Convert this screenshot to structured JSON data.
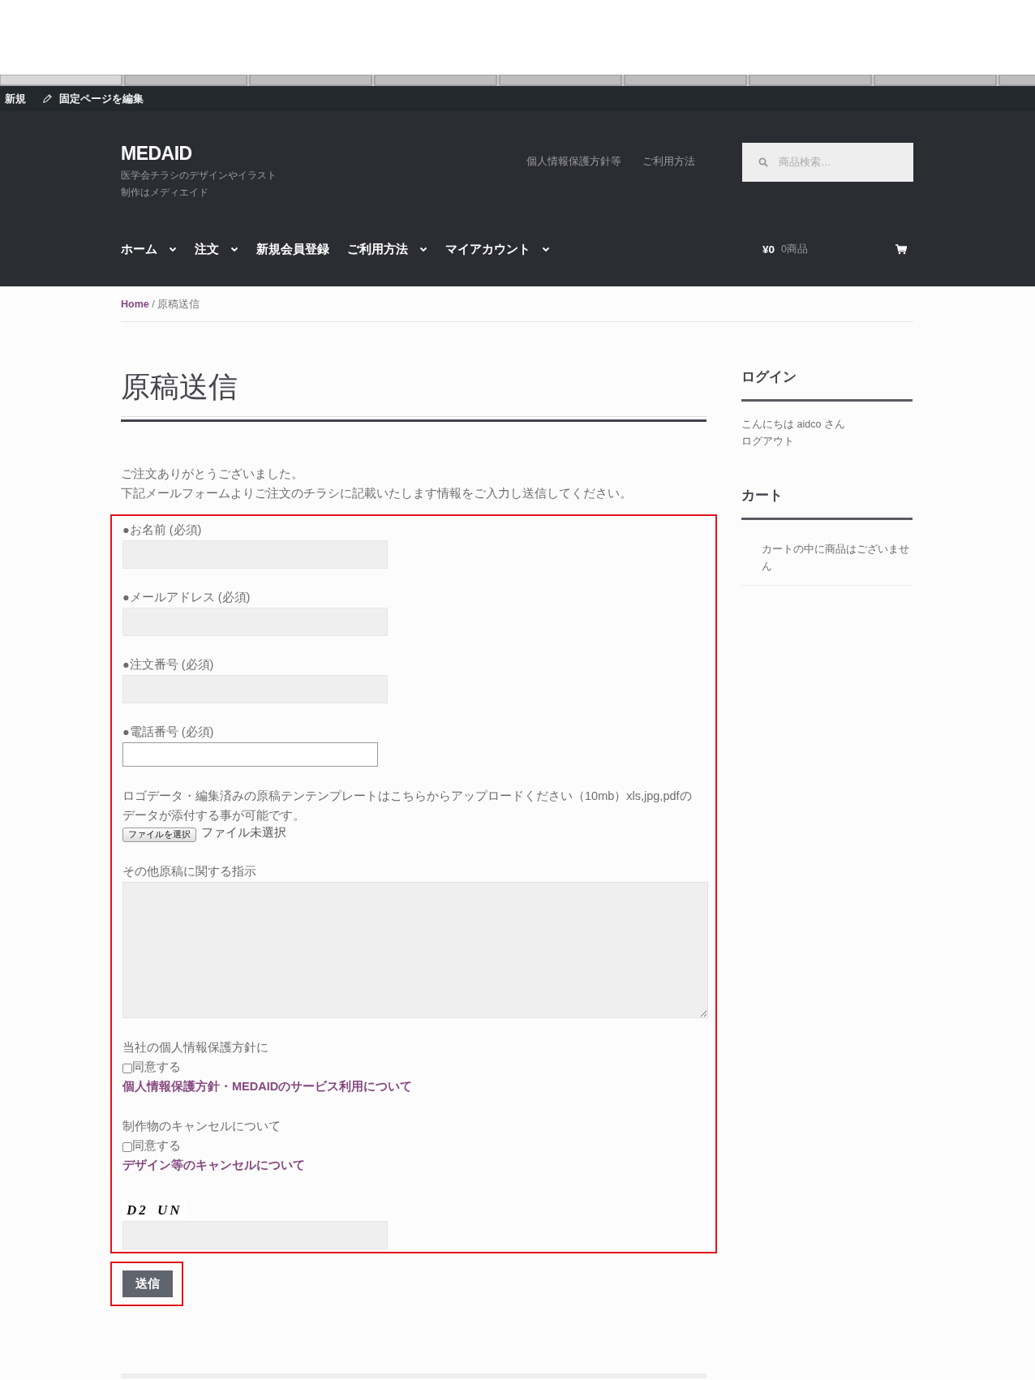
{
  "admin_bar": {
    "new": "新規",
    "edit": "固定ページを編集"
  },
  "header": {
    "site_title": "MEDAID",
    "tagline": [
      "医学会チラシのデザインやイラスト",
      "制作はメディエイド"
    ],
    "top_links": [
      "個人情報保護方針等",
      "ご利用方法"
    ],
    "search": {
      "placeholder": "商品検索…"
    },
    "nav": [
      {
        "label": "ホーム",
        "has_submenu": true
      },
      {
        "label": "注文",
        "has_submenu": true
      },
      {
        "label": "新規会員登録",
        "has_submenu": false
      },
      {
        "label": "ご利用方法",
        "has_submenu": true
      },
      {
        "label": "マイアカウント",
        "has_submenu": true
      }
    ],
    "cart": {
      "amount": "¥0",
      "count": "0商品"
    }
  },
  "breadcrumb": {
    "home": "Home",
    "separator": "/",
    "current": "原稿送信"
  },
  "page": {
    "title": "原稿送信",
    "intro": [
      "ご注文ありがとうございました。",
      "下記メールフォームよりご注文のチラシに記載いたします情報をご入力し送信してください。"
    ]
  },
  "form": {
    "highlighted": true,
    "fields": [
      {
        "label": "●お名前 (必須)",
        "kind": "shaded"
      },
      {
        "label": "●メールアドレス (必須)",
        "kind": "shaded"
      },
      {
        "label": "●注文番号 (必須)",
        "kind": "shaded"
      },
      {
        "label": "●電話番号 (必須)",
        "kind": "plain"
      }
    ],
    "upload": {
      "text": "ロゴデータ・編集済みの原稿テンテンプレートはこちらからアップロードください（10mb）xls,jpg,pdfのデータが添付する事が可能です。",
      "button": "ファイルを選択",
      "status": "ファイル未選択"
    },
    "message": {
      "label": "その他原稿に関する指示"
    },
    "agreements": [
      {
        "text": "当社の個人情報保護方針に",
        "checkbox": "同意する",
        "checked": false,
        "link": "個人情報保護方針・MEDAIDのサービス利用について"
      },
      {
        "text": "制作物のキャンセルについて",
        "checkbox": "同意する",
        "checked": false,
        "link": "デザイン等のキャンセルについて"
      }
    ],
    "captcha": "D2 UN",
    "submit": {
      "label": "送信",
      "highlighted": true
    }
  },
  "sidebar": [
    {
      "title": "ログイン",
      "lines": [
        "こんにちは aidco さん",
        "ログアウト"
      ]
    },
    {
      "title": "カート",
      "lines": [
        "カートの中に商品はございません"
      ]
    }
  ]
}
